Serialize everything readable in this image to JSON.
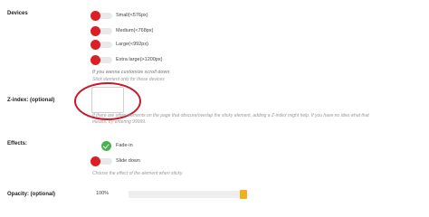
{
  "devices": {
    "label": "Devices",
    "options": [
      {
        "label": "Small(<576px)",
        "enabled": false
      },
      {
        "label": "Medium(<768px)",
        "enabled": false
      },
      {
        "label": "Large(<992px)",
        "enabled": false
      },
      {
        "label": "Extra large(>1200px)",
        "enabled": false
      }
    ],
    "hint_bold": "If you wanna customize scroll down",
    "hint": "Stick element only for these devices"
  },
  "zindex": {
    "label": "Z-index: (optional)",
    "value": "",
    "hint_line1": "If there are other elements on the page that obscure/overlap the sticky element, adding a Z-index might help. If you have no idea what that",
    "hint_line2": "means, try entering 99999."
  },
  "effects": {
    "label": "Effects:",
    "options": [
      {
        "label": "Fade-in",
        "enabled": true
      },
      {
        "label": "Slide down",
        "enabled": false
      }
    ],
    "hint": "Choose the effect of the element when sticky"
  },
  "opacity": {
    "label": "Opacity: (optional)",
    "value_text": "100%",
    "value": 1.0
  },
  "colors": {
    "off": "#dc1f26",
    "on": "#4caf50",
    "annotation": "#c8182a",
    "slider_handle": "#f2b01e"
  }
}
